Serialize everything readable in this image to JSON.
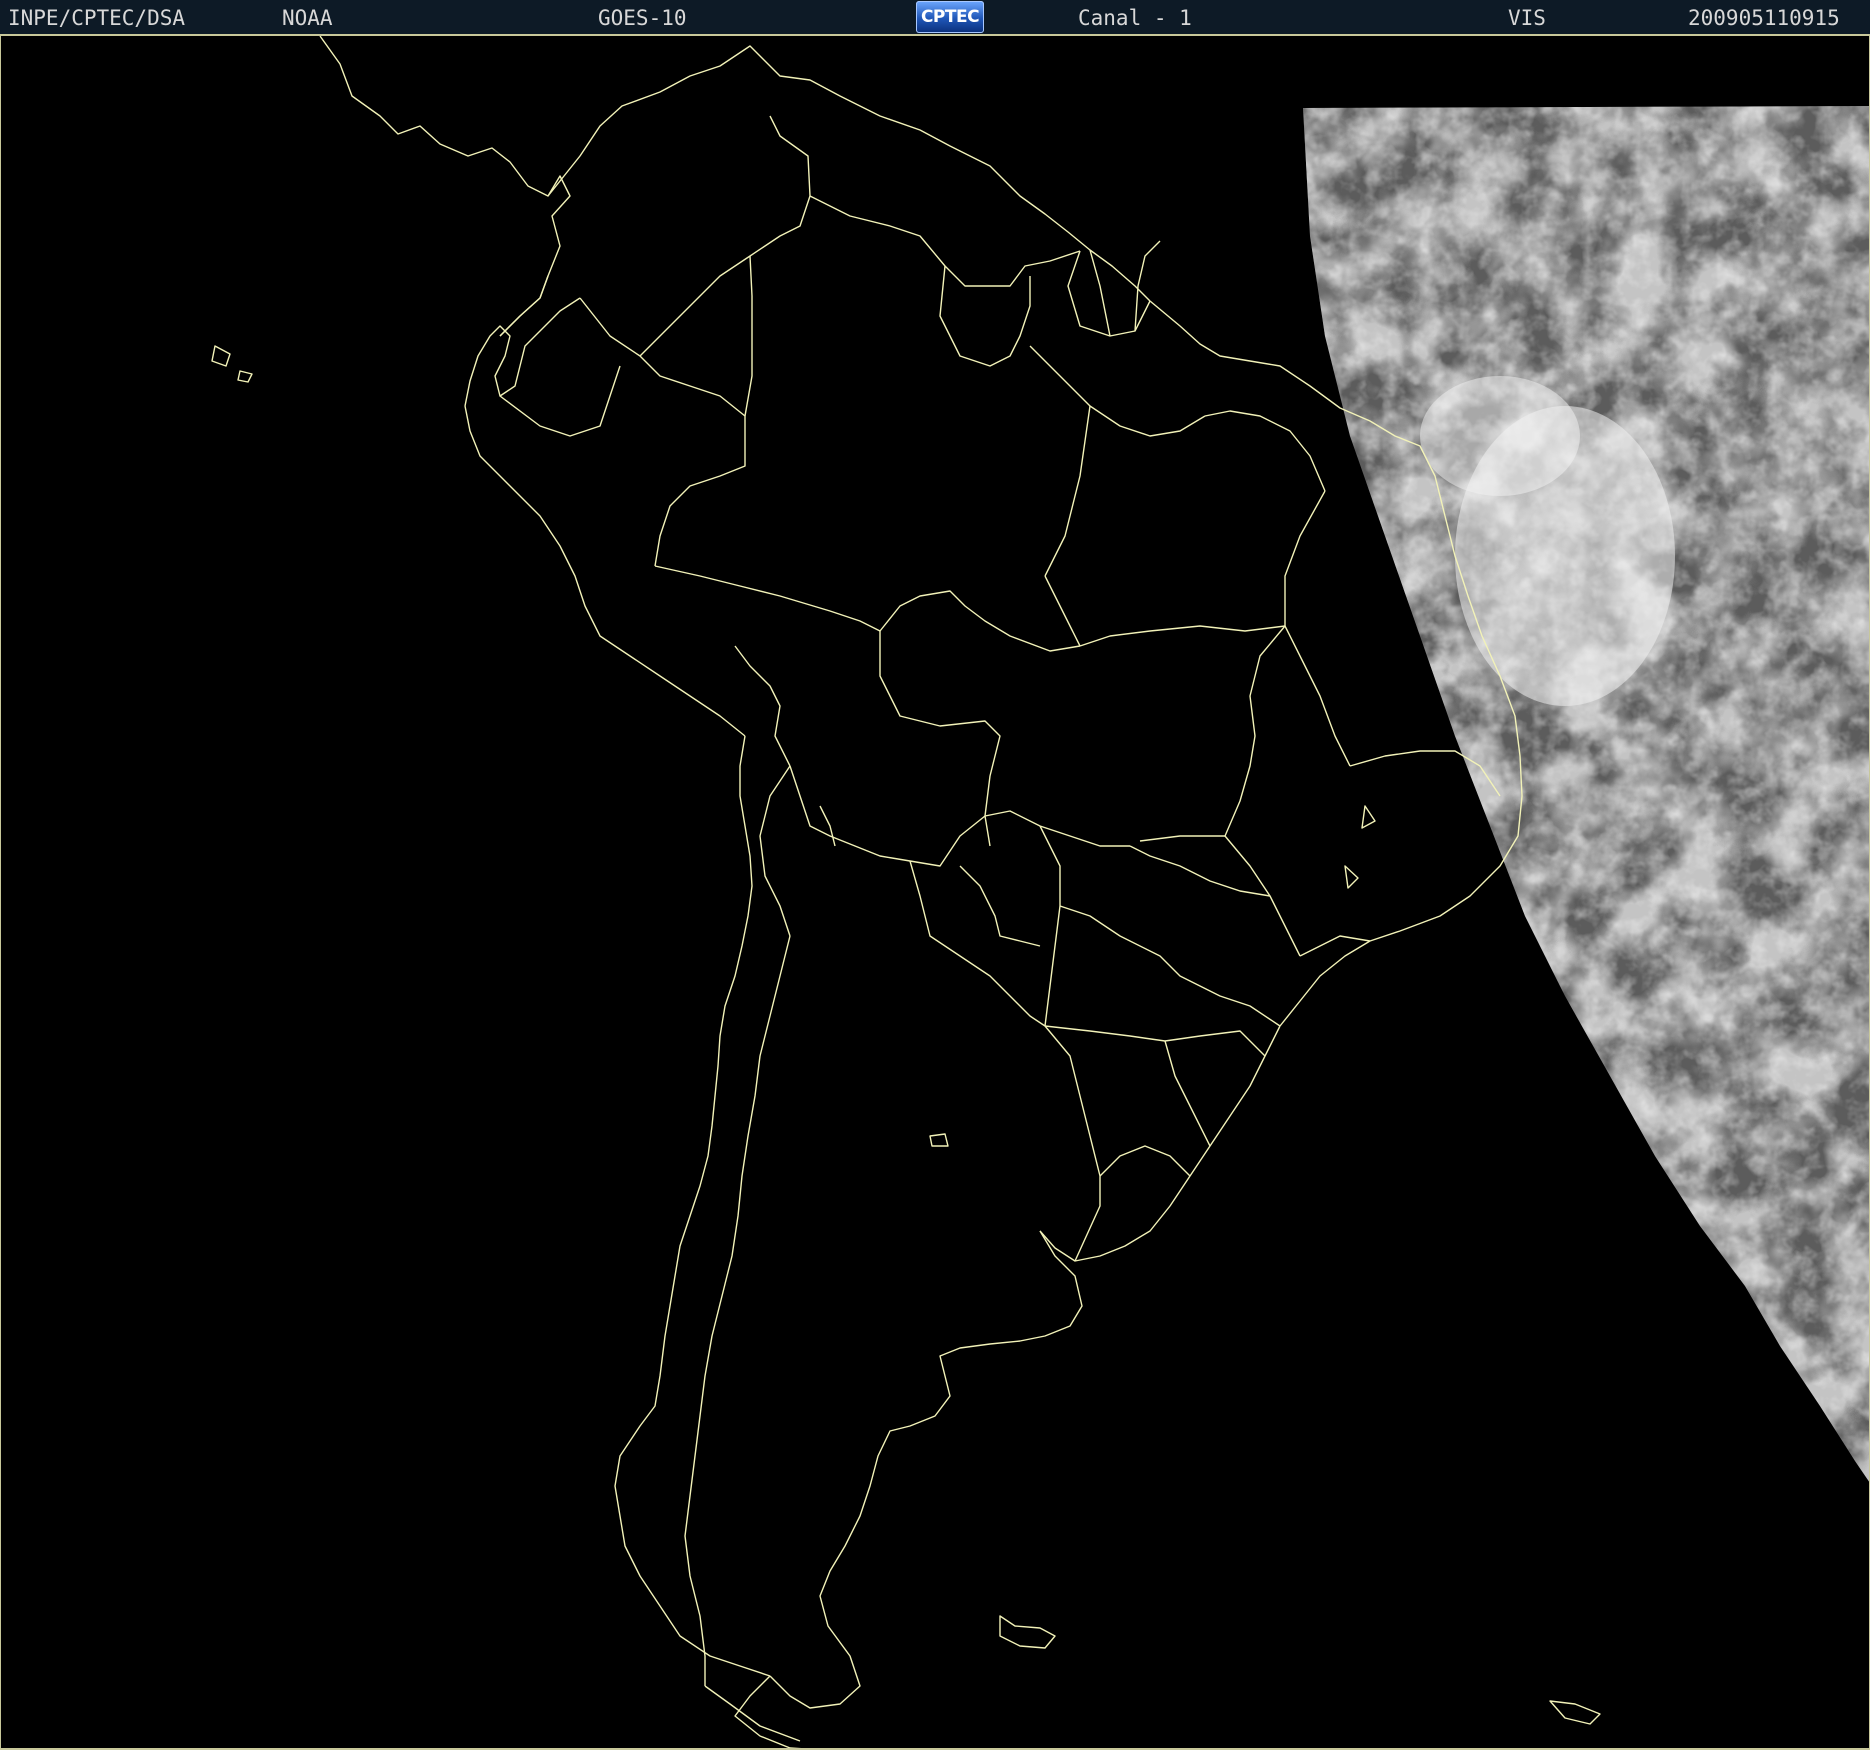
{
  "header": {
    "agency": "INPE/CPTEC/DSA",
    "source": "NOAA",
    "satellite": "GOES-10",
    "logo": "CPTEC",
    "channel": "Canal - 1",
    "band": "VIS",
    "timestamp": "200905110915"
  },
  "map": {
    "background_color": "#000000",
    "outline_color": "#f2f2b8",
    "cloud_color": "#e6e6e6"
  }
}
